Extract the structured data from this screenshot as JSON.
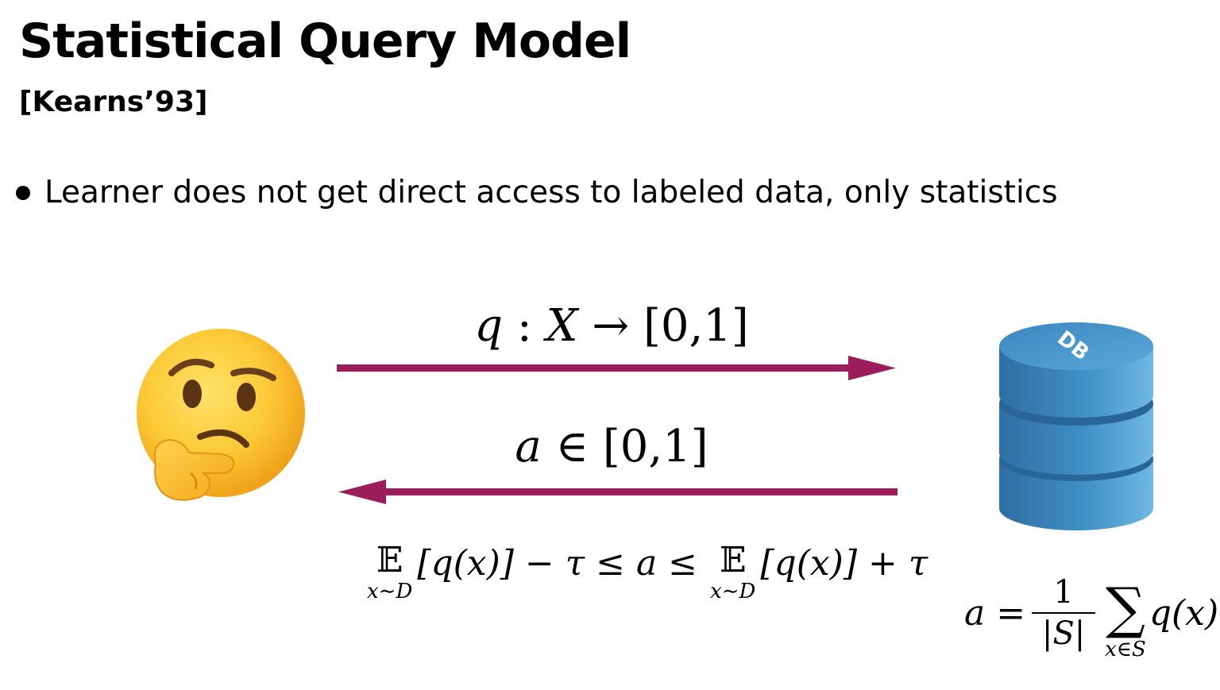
{
  "slide": {
    "title": "Statistical Query Model",
    "citation": "[Kearns’93]",
    "bullet": "Learner does not get direct access to labeled data, only statistics"
  },
  "diagram": {
    "learner_icon": "thinking-face-emoji",
    "database_icon": "database-cylinder-icon",
    "database_label": "DB",
    "arrow_color": "#9b1d5a",
    "query": {
      "q": "q",
      "colon": " : ",
      "X": "X",
      "arrow": " → ",
      "range": "[0,1]"
    },
    "answer": {
      "a": "a",
      "in": " ∈ ",
      "range": "[0,1]"
    },
    "bounds": {
      "E": "𝔼",
      "sub": "x∼D",
      "left_expr": "[q(x)] − τ ≤ a ≤",
      "right_expr": "[q(x)] + τ"
    },
    "average": {
      "lhs": "a =",
      "num": "1",
      "den": "|S|",
      "sum": "∑",
      "sum_sub": "x∈S",
      "term": "q(x)"
    }
  }
}
